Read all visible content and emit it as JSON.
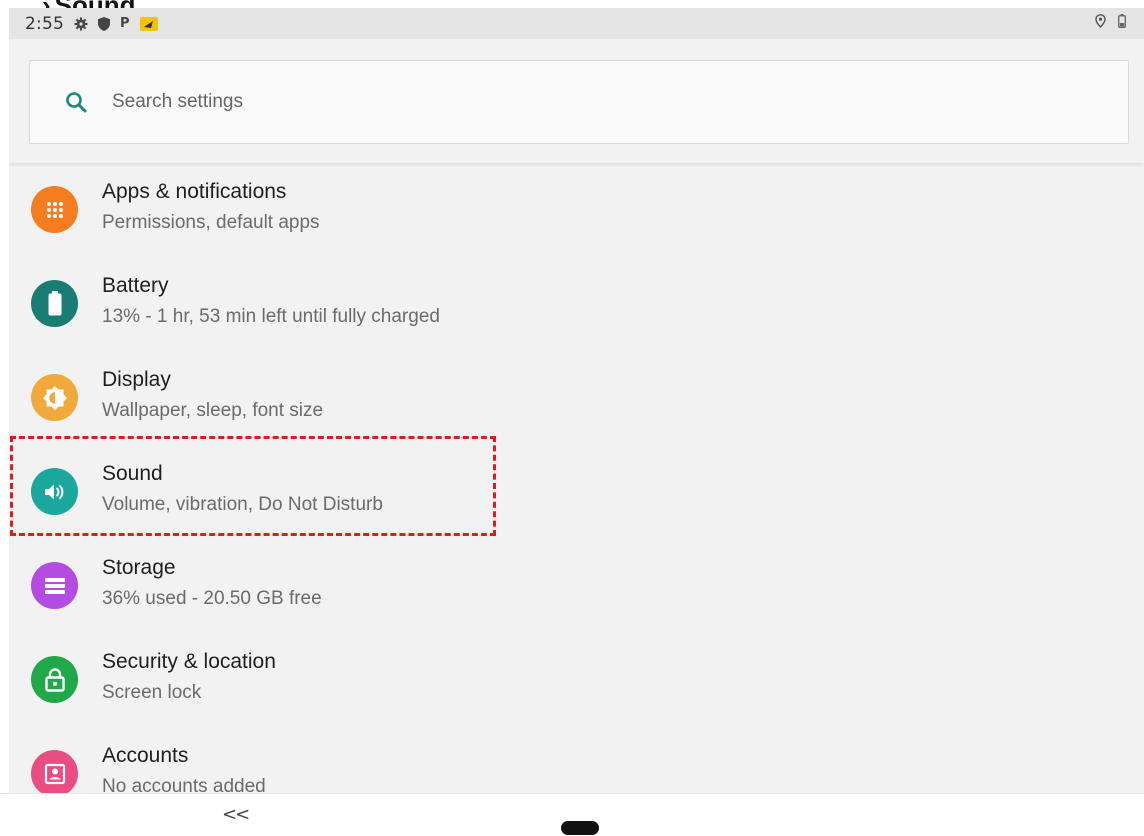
{
  "heading": {
    "arrow": "›",
    "text": "Sound"
  },
  "status_bar": {
    "time": "2:55",
    "icons": [
      "gear-icon",
      "shield-icon",
      "parking-icon",
      "notification-icon"
    ],
    "p_letter": "P",
    "right_icons": [
      "location-icon",
      "battery-icon"
    ]
  },
  "search": {
    "placeholder": "Search settings"
  },
  "items": [
    {
      "title": "Apps & notifications",
      "subtitle": "Permissions, default apps",
      "color": "#f57c1f",
      "icon": "apps-grid-icon"
    },
    {
      "title": "Battery",
      "subtitle": "13% - 1 hr, 53 min left until fully charged",
      "color": "#1a7d73",
      "icon": "battery-icon"
    },
    {
      "title": "Display",
      "subtitle": "Wallpaper, sleep, font size",
      "color": "#f2a93b",
      "icon": "brightness-icon"
    },
    {
      "title": "Sound",
      "subtitle": "Volume, vibration, Do Not Disturb",
      "color": "#19a89b",
      "icon": "volume-icon"
    },
    {
      "title": "Storage",
      "subtitle": "36% used - 20.50 GB free",
      "color": "#b54ce2",
      "icon": "storage-icon"
    },
    {
      "title": "Security & location",
      "subtitle": "Screen lock",
      "color": "#21a84a",
      "icon": "lock-icon"
    },
    {
      "title": "Accounts",
      "subtitle": "No accounts added",
      "color": "#ea4d81",
      "icon": "account-icon"
    }
  ],
  "highlight_color": "#e01b1b",
  "nav": {
    "back": "<<"
  }
}
